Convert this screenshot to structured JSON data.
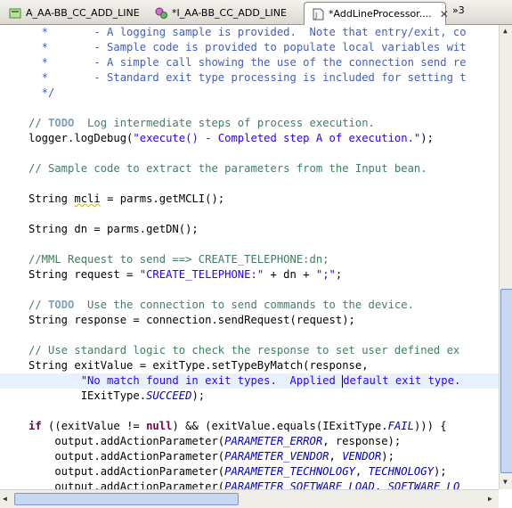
{
  "tabs": [
    {
      "label": "A_AA-BB_CC_ADD_LINE",
      "icon": "diagram-icon",
      "active": false
    },
    {
      "label": "*I_AA-BB_CC_ADD_LINE",
      "icon": "gear-icon",
      "active": false
    },
    {
      "label": "*AddLineProcessor....",
      "icon": "java-file-icon",
      "active": true
    }
  ],
  "overflow_count": "»3",
  "code": {
    "l1": "  *       - A logging sample is provided.  Note that entry/exit, co",
    "l2": "  *       - Sample code is provided to populate local variables wit",
    "l3": "  *       - A simple call showing the use of the connection send re",
    "l4": "  *       - Standard exit type processing is included for setting t",
    "l5": "  */",
    "todo1_a": "// ",
    "todo1_kw": "TODO",
    "todo1_b": "  Log intermediate steps of process execution.",
    "log_a": "logger.logDebug(",
    "log_s": "\"execute() - Completed step A of execution.\"",
    "log_b": ");",
    "sample": "// Sample code to extract the parameters from the Input bean.",
    "mcli_a": "String ",
    "mcli_var": "mcli",
    "mcli_b": " = parms.getMCLI();",
    "dn": "String dn = parms.getDN();",
    "mml": "//MML Request to send ==> CREATE_TELEPHONE:dn;",
    "req_a": "String request = ",
    "req_s": "\"CREATE_TELEPHONE:\"",
    "req_b": " + dn + ",
    "req_s2": "\";\"",
    "req_c": ";",
    "todo2_a": "// ",
    "todo2_kw": "TODO",
    "todo2_b": "  Use the connection to send commands to the device.",
    "resp": "String response = connection.sendRequest(request);",
    "std": "// Use standard logic to check the response to set user defined ex",
    "exit": "String exitValue = exitType.setTypeByMatch(response,",
    "nomatch_a": "        \"No match found in exit types.  Applied ",
    "nomatch_b": "default exit type.",
    "iexit_a": "        IExitType.",
    "iexit_st": "SUCCEED",
    "iexit_b": ");",
    "if_kw": "if",
    "if_a": " ((exitValue != ",
    "if_null": "null",
    "if_b": ") && (exitValue.equals(IExitType.",
    "if_fail": "FAIL",
    "if_c": "))) {",
    "out_pre": "    output.addActionParameter(",
    "p1": "PARAMETER_ERROR",
    "p1b": ", response);",
    "p2": "PARAMETER_VENDOR",
    "p2c": "VENDOR",
    "p3": "PARAMETER_TECHNOLOGY",
    "p3c": "TECHNOLOGY",
    "p4": "PARAMETER_SOFTWARE_LOAD",
    "p4c": "SOFTWARE_LO",
    "sep": ", ",
    "close": ");"
  },
  "colors": {
    "comment": "#3f7f5f",
    "keyword": "#7f0055",
    "string": "#2a00ff",
    "static": "#0000c0",
    "current_line": "#e8f2fe"
  }
}
